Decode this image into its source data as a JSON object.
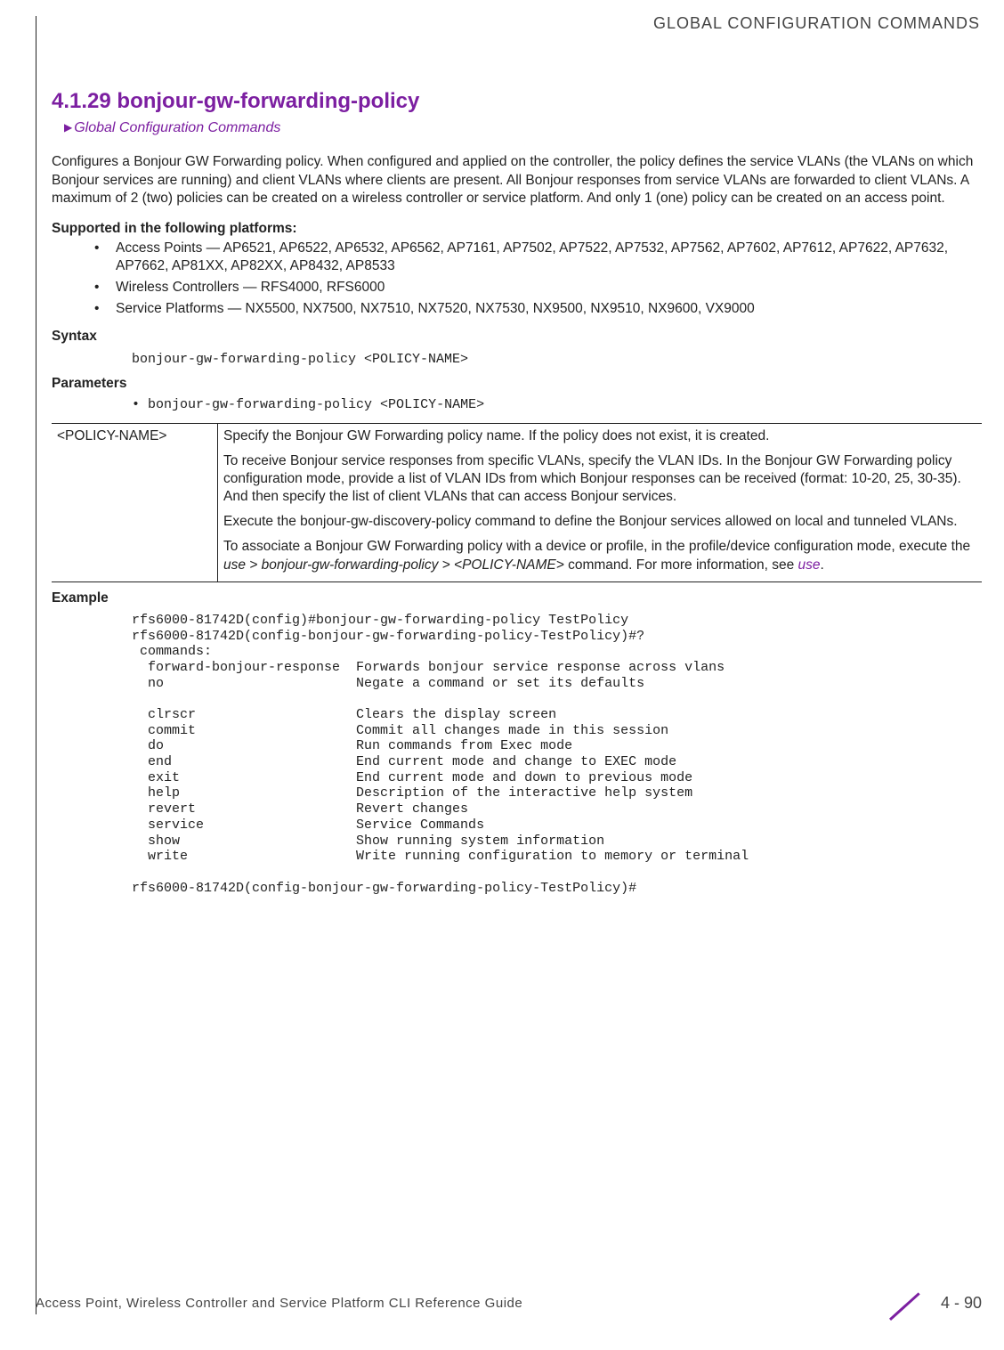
{
  "running_header": "GLOBAL CONFIGURATION COMMANDS",
  "section": {
    "number": "4.1.29",
    "title": "bonjour-gw-forwarding-policy",
    "breadcrumb": "Global Configuration Commands"
  },
  "intro": "Configures a Bonjour GW Forwarding policy. When configured and applied on the controller, the policy defines the service VLANs (the VLANs on which Bonjour services are running) and client VLANs where clients are present. All Bonjour responses from service VLANs are forwarded to client VLANs. A maximum of 2 (two) policies can be created on a wireless controller or service platform. And only 1 (one) policy can be created on an access point.",
  "supported_heading": "Supported in the following platforms:",
  "platforms": [
    "Access Points — AP6521, AP6522, AP6532, AP6562, AP7161, AP7502, AP7522, AP7532, AP7562, AP7602, AP7612, AP7622, AP7632, AP7662, AP81XX, AP82XX, AP8432, AP8533",
    "Wireless Controllers — RFS4000, RFS6000",
    "Service Platforms — NX5500, NX7500, NX7510, NX7520, NX7530, NX9500, NX9510, NX9600, VX9000"
  ],
  "syntax_heading": "Syntax",
  "syntax_line": "bonjour-gw-forwarding-policy <POLICY-NAME>",
  "parameters_heading": "Parameters",
  "parameters_bullet": "bonjour-gw-forwarding-policy <POLICY-NAME>",
  "param_table": {
    "left": "<POLICY-NAME>",
    "right": {
      "p1": "Specify the Bonjour GW Forwarding policy name. If the policy does not exist, it is created.",
      "p2": "To receive Bonjour service responses from specific VLANs, specify the VLAN IDs. In the Bonjour GW Forwarding policy configuration mode, provide a list of VLAN IDs from which Bonjour responses can be received (format: 10-20, 25, 30-35). And then specify the list of client VLANs that can access Bonjour services.",
      "p3": "Execute the bonjour-gw-discovery-policy command to define the Bonjour services allowed on local and tunneled VLANs.",
      "p4_pre": "To associate a Bonjour GW Forwarding policy with a device or profile, in the profile/device configuration mode, execute the ",
      "p4_cmd": "use > bonjour-gw-forwarding-policy > <POLICY-NAME>",
      "p4_mid": " command. For more information, see ",
      "p4_link": "use",
      "p4_post": "."
    }
  },
  "example_heading": "Example",
  "example_block": "rfs6000-81742D(config)#bonjour-gw-forwarding-policy TestPolicy\nrfs6000-81742D(config-bonjour-gw-forwarding-policy-TestPolicy)#?\n commands:\n  forward-bonjour-response  Forwards bonjour service response across vlans\n  no                        Negate a command or set its defaults\n\n  clrscr                    Clears the display screen\n  commit                    Commit all changes made in this session\n  do                        Run commands from Exec mode\n  end                       End current mode and change to EXEC mode\n  exit                      End current mode and down to previous mode\n  help                      Description of the interactive help system\n  revert                    Revert changes\n  service                   Service Commands\n  show                      Show running system information\n  write                     Write running configuration to memory or terminal\n\nrfs6000-81742D(config-bonjour-gw-forwarding-policy-TestPolicy)#",
  "footer": {
    "doc_title": "Access Point, Wireless Controller and Service Platform CLI Reference Guide",
    "page_num": "4 - 90"
  }
}
